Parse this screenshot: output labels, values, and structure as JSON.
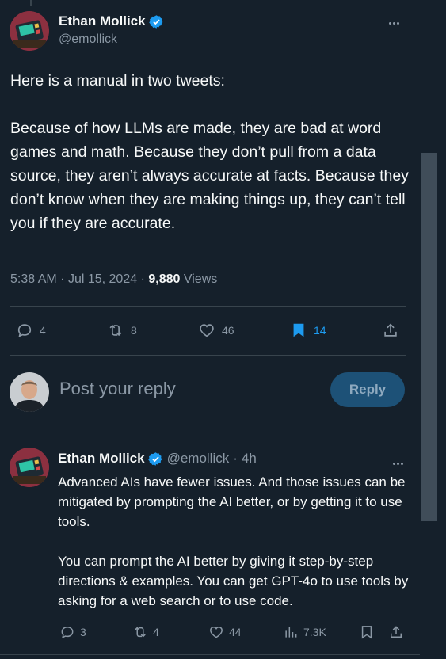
{
  "colors": {
    "background": "#15202b",
    "accent": "#1d9bf0",
    "muted": "#8b98a5",
    "text": "#f7f9f9",
    "divider": "#38444d"
  },
  "tweet": {
    "author_name": "Ethan Mollick",
    "author_handle": "@emollick",
    "text": "Here is a manual in two tweets:\n\nBecause of how LLMs are made, they are bad at word games and math. Because they don’t pull from a data source, they aren’t always accurate at facts. Because they don’t know when they are making things up, they can’t tell you if they are accurate.",
    "time": "5:38 AM",
    "date": "Jul 15, 2024",
    "views_count": "9,880",
    "views_label": "Views",
    "replies": "4",
    "reposts": "8",
    "likes": "46",
    "bookmarks": "14"
  },
  "compose": {
    "placeholder": "Post your reply",
    "button_label": "Reply"
  },
  "reply": {
    "author_name": "Ethan Mollick",
    "author_handle": "@emollick",
    "separator": "·",
    "age": "4h",
    "text": "Advanced AIs have fewer issues. And those issues can be mitigated by prompting the AI better, or by getting it to use tools.\n\nYou can prompt the AI better by giving it step-by-step directions & examples. You can get GPT-4o to use tools by asking for a web search or to use code.",
    "replies": "3",
    "reposts": "4",
    "likes": "44",
    "views": "7.3K"
  }
}
